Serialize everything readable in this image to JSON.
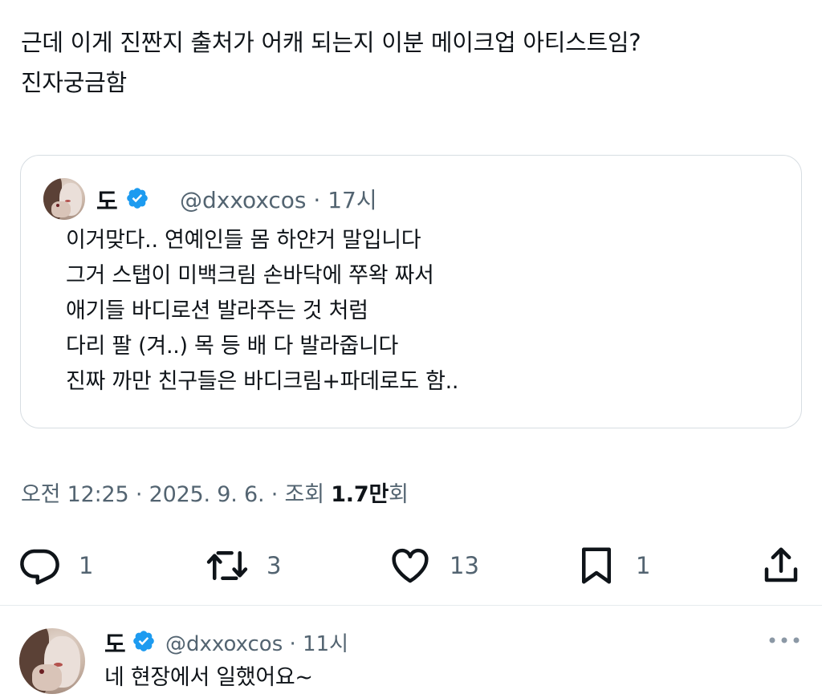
{
  "main_tweet": {
    "text": "근데 이게 진짠지 출처가 어캐 되는지 이분 메이크업 아티스트임?\n진자궁금함"
  },
  "quote": {
    "author_name": "도",
    "handle_time": "@dxxoxcos · 17시",
    "lines": [
      "이거맞다.. 연예인들 몸 하얀거 말입니다",
      "그거 스탭이 미백크림 손바닥에 쭈왁 짜서",
      "애기들 바디로션 발라주는 것 처럼",
      "다리 팔 (겨..) 목 등 배 다 발라줍니다",
      "진짜 까만 친구들은 바디크림+파데로도 함.."
    ]
  },
  "meta": {
    "timestamp": "오전 12:25 · 2025. 9. 6. · 조회 ",
    "views": "1.7만",
    "views_suffix": "회"
  },
  "actions": {
    "reply_count": "1",
    "retweet_count": "3",
    "like_count": "13",
    "bookmark_count": "1"
  },
  "reply": {
    "author_name": "도",
    "handle_time": "@dxxoxcos · 11시",
    "text": "네 현장에서 일했어요~"
  },
  "colors": {
    "verified": "#1d9bf0",
    "secondary_text": "#536471",
    "primary_text": "#0f1419",
    "border": "#d7dde2"
  },
  "icons": [
    "verified-badge-icon",
    "reply-icon",
    "retweet-icon",
    "like-icon",
    "bookmark-icon",
    "share-icon",
    "more-icon"
  ]
}
